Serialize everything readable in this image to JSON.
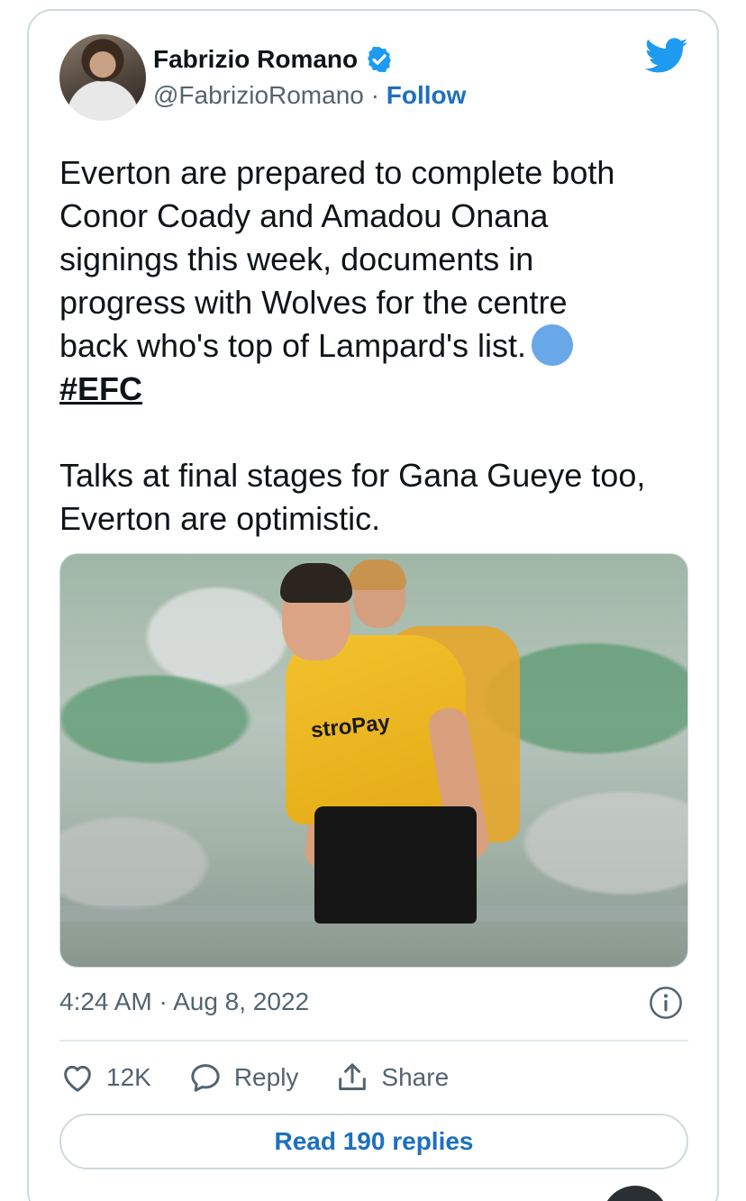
{
  "tweet": {
    "author_name": "Fabrizio Romano",
    "handle": "@FabrizioRomano",
    "separator": " · ",
    "follow_label": "Follow",
    "text_main": "Everton are prepared to complete both\nConor Coady and Amadou Onana\nsignings this week, documents in\nprogress with Wolves for the centre\nback who's top of Lampard's list.",
    "hashtag": "#EFC",
    "text_secondary": "Talks at final stages for Gana Gueye too,\nEverton are optimistic.",
    "media": {
      "sponsor_text": "stroPay"
    },
    "timestamp": "4:24 AM · Aug 8, 2022",
    "likes_count": "12K",
    "reply_label": "Reply",
    "share_label": "Share",
    "read_replies_label": "Read 190 replies"
  },
  "colors": {
    "accent": "#1d6fbf",
    "twitter_blue": "#1d9bf0",
    "muted_text": "#536471",
    "border": "#cfd9de"
  },
  "icons": [
    "verified-badge-icon",
    "twitter-bird-icon",
    "info-icon",
    "heart-icon",
    "reply-bubble-icon",
    "share-icon"
  ]
}
